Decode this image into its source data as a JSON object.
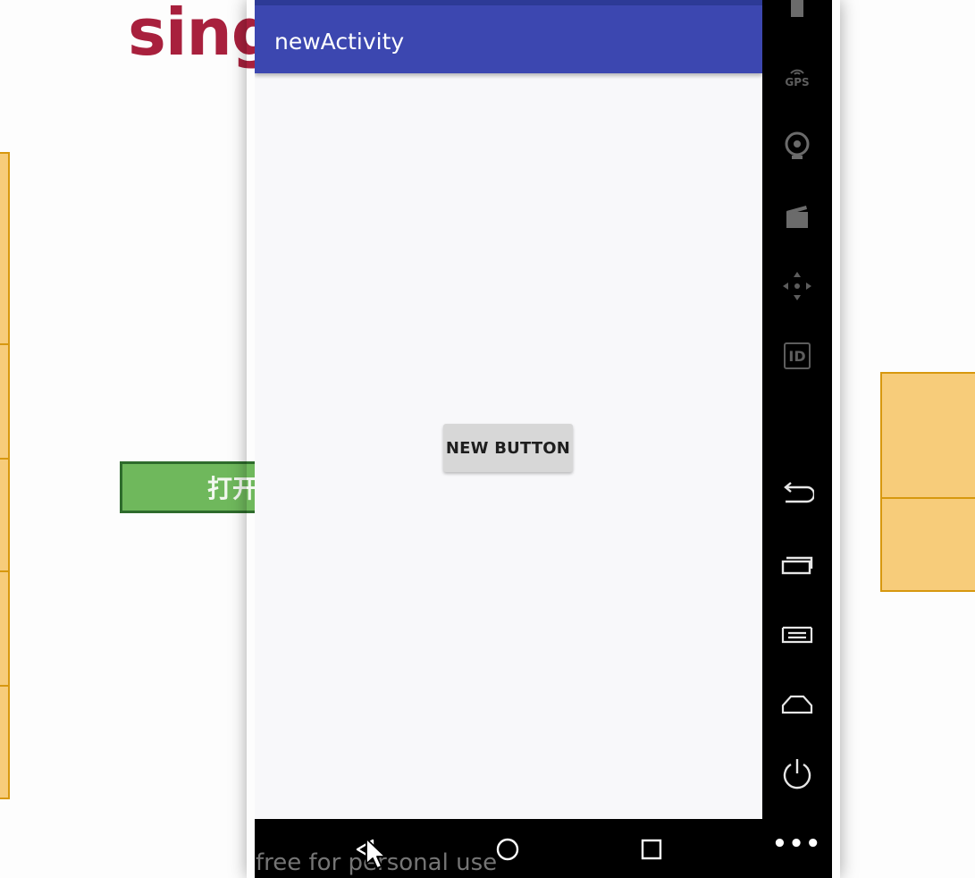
{
  "slide": {
    "title_partial": "sing",
    "green_button_label": "打开"
  },
  "app": {
    "title": "newActivity",
    "button_label": "NEW BUTTON"
  },
  "nav": {
    "back_icon": "back-triangle-icon",
    "home_icon": "home-circle-icon",
    "recents_icon": "recents-square-icon"
  },
  "emulator_toolbar": {
    "gps_label": "GPS",
    "id_label": "ID",
    "more_label": "•••"
  },
  "watermark": "free for personal use",
  "colors": {
    "app_bar": "#3c47b0",
    "status_bar": "#2d3a96",
    "button": "#d7d7d7",
    "slide_title": "#a8203d",
    "slide_box": "#f7cc7a",
    "slide_green": "#6fb85c"
  }
}
